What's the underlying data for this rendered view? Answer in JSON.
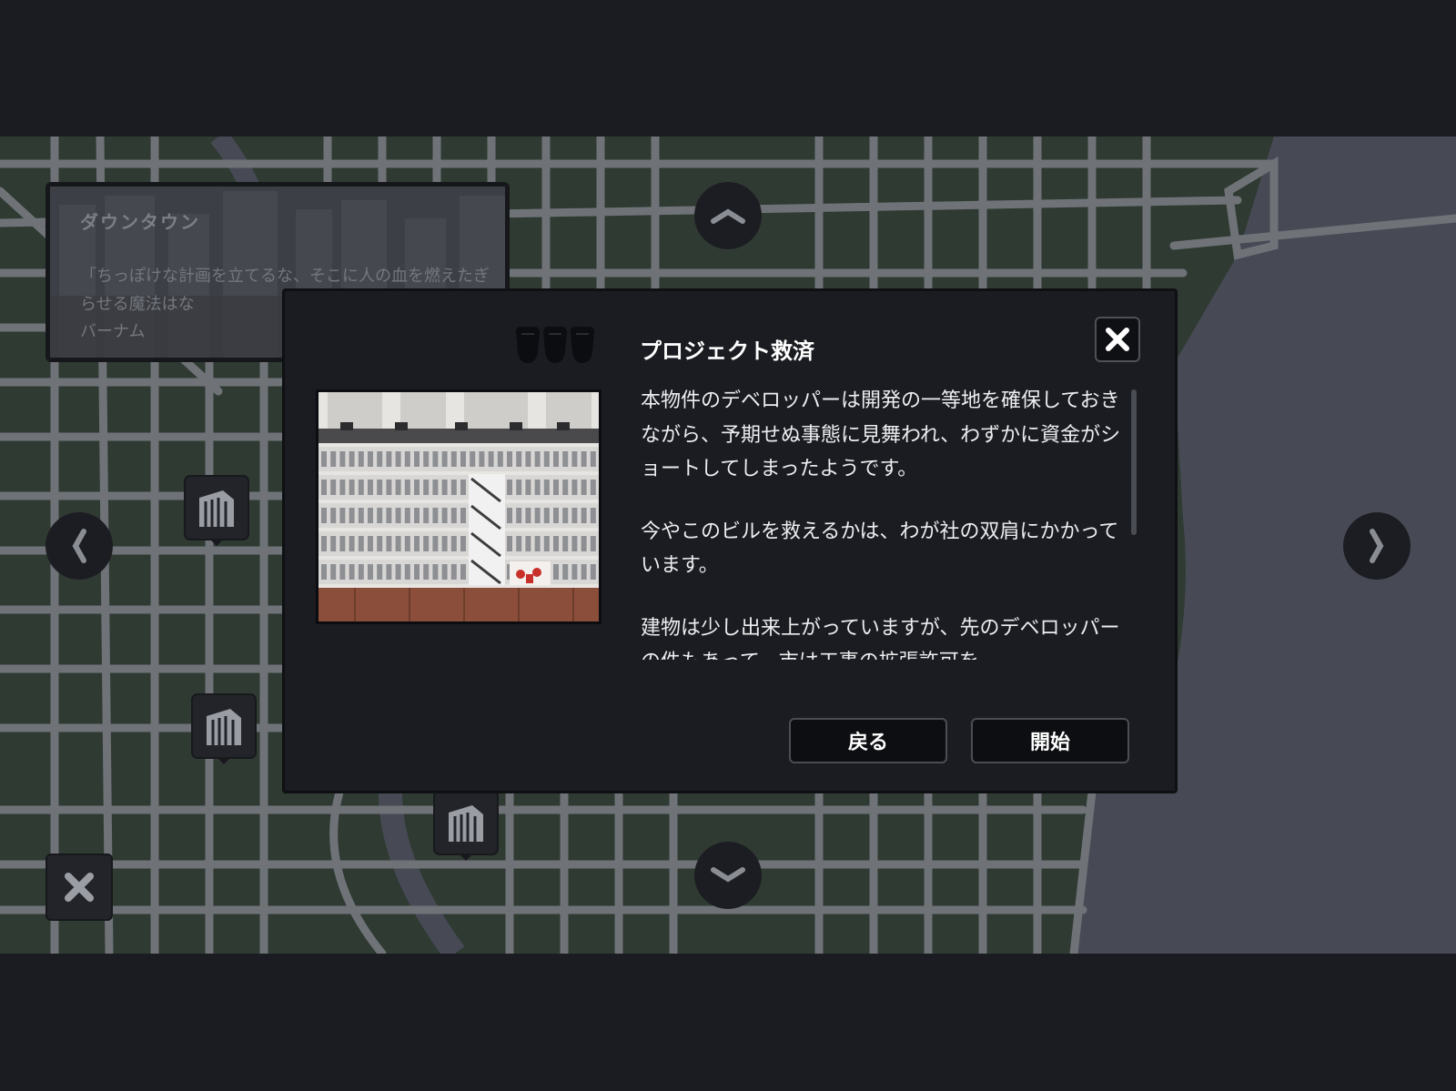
{
  "district": {
    "title": "ダウンタウン",
    "quote": "「ちっぽけな計画を立てるな、そこに人の血を燃えたぎらせる魔法はな",
    "author": "バーナム"
  },
  "modal": {
    "title": "プロジェクト救済",
    "difficulty_icon": "fist-icons",
    "paragraphs": [
      "本物件のデベロッパーは開発の一等地を確保しておきながら、予期せぬ事態に見舞われ、わずかに資金がショートしてしまったようです。",
      "今やこのビルを救えるかは、わが社の双肩にかかっています。",
      "建物は少し出来上がっていますが、先のデベロッパーの件もあって、市は工事の拡張許可を"
    ],
    "scroll_position": 0.0,
    "back_label": "戻る",
    "start_label": "開始"
  },
  "nav": {
    "up": "chevron-up-icon",
    "down": "chevron-down-icon",
    "left": "chevron-left-icon",
    "right": "chevron-right-icon",
    "close": "close-icon"
  },
  "colors": {
    "map_land": "#2f3a32",
    "map_water": "#474a55",
    "map_road": "#6f7378",
    "panel_bg": "#1b1c21",
    "border": "#4b4d55",
    "text": "#eceef0"
  }
}
